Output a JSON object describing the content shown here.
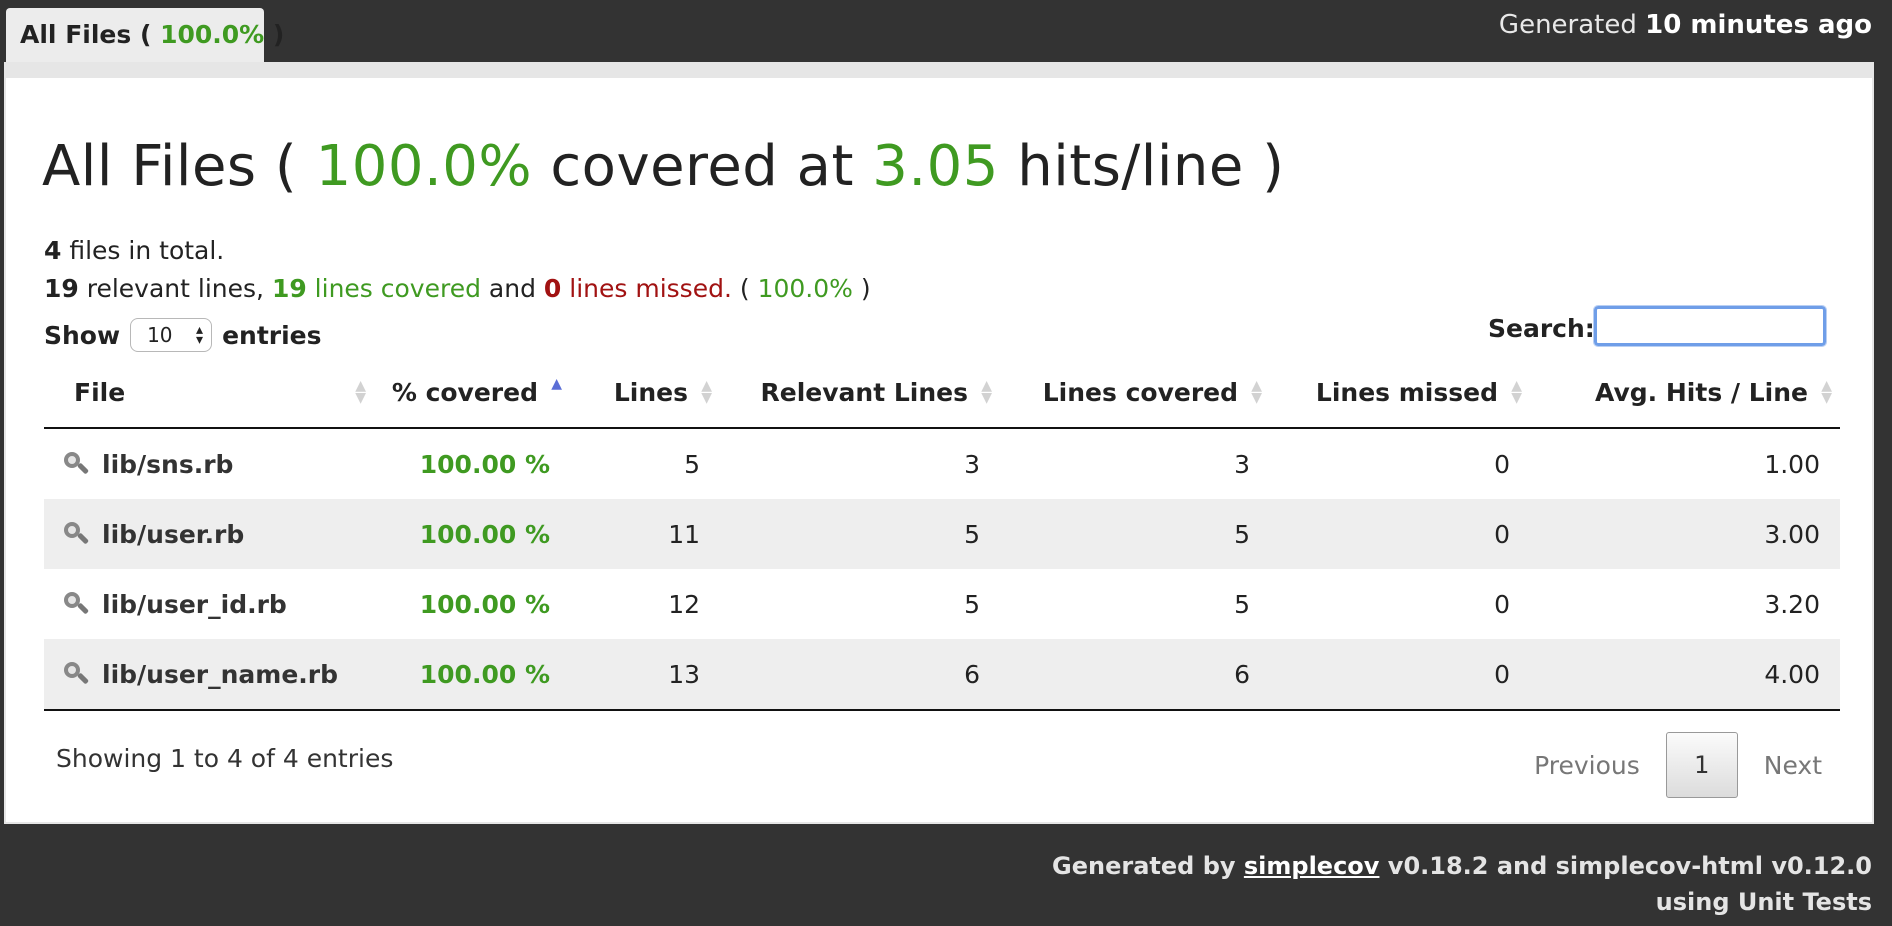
{
  "header": {
    "tab": {
      "label_prefix": "All Files ( ",
      "coverage": "100.0%",
      "label_suffix": " )"
    },
    "generated_prefix": "Generated ",
    "generated_time": "10 minutes ago"
  },
  "main": {
    "title": {
      "prefix": "All Files ( ",
      "coverage": "100.0%",
      "middle": " covered at ",
      "hits": "3.05",
      "suffix": " hits/line )"
    },
    "summary": {
      "files_count": "4",
      "files_text": " files in total.",
      "relevant_lines": "19",
      "relevant_text": " relevant lines, ",
      "covered_count": "19",
      "covered_text": " lines covered",
      "and_text": " and ",
      "missed_count": "0",
      "missed_text": " lines missed.",
      "pct_open": " ( ",
      "pct": "100.0%",
      "pct_close": " )"
    },
    "show_label": "Show",
    "page_size": "10",
    "entries_label": "entries",
    "search_label": "Search:",
    "search_value": "",
    "columns": [
      "File",
      "% covered",
      "Lines",
      "Relevant Lines",
      "Lines covered",
      "Lines missed",
      "Avg. Hits / Line"
    ],
    "rows": [
      {
        "file": "lib/sns.rb",
        "covered": "100.00 %",
        "lines": "5",
        "relevant": "3",
        "lines_covered": "3",
        "missed": "0",
        "avg_hits": "1.00"
      },
      {
        "file": "lib/user.rb",
        "covered": "100.00 %",
        "lines": "11",
        "relevant": "5",
        "lines_covered": "5",
        "missed": "0",
        "avg_hits": "3.00"
      },
      {
        "file": "lib/user_id.rb",
        "covered": "100.00 %",
        "lines": "12",
        "relevant": "5",
        "lines_covered": "5",
        "missed": "0",
        "avg_hits": "3.20"
      },
      {
        "file": "lib/user_name.rb",
        "covered": "100.00 %",
        "lines": "13",
        "relevant": "6",
        "lines_covered": "6",
        "missed": "0",
        "avg_hits": "4.00"
      }
    ],
    "info": "Showing 1 to 4 of 4 entries",
    "pagination": {
      "previous": "Previous",
      "current": "1",
      "next": "Next"
    }
  },
  "footer": {
    "line1_prefix": "Generated by ",
    "link": "simplecov",
    "line1_suffix": " v0.18.2 and simplecov-html v0.12.0",
    "line2": "using Unit Tests"
  },
  "colors": {
    "background": "#333333",
    "covered_green": "#3f9a21",
    "missed_red": "#a11212",
    "search_focus": "#6f9ee8"
  },
  "icons": {
    "file_row": "magnifier-icon",
    "sort": "sort-arrows-icon",
    "sort_active": "sort-ascending-icon"
  }
}
